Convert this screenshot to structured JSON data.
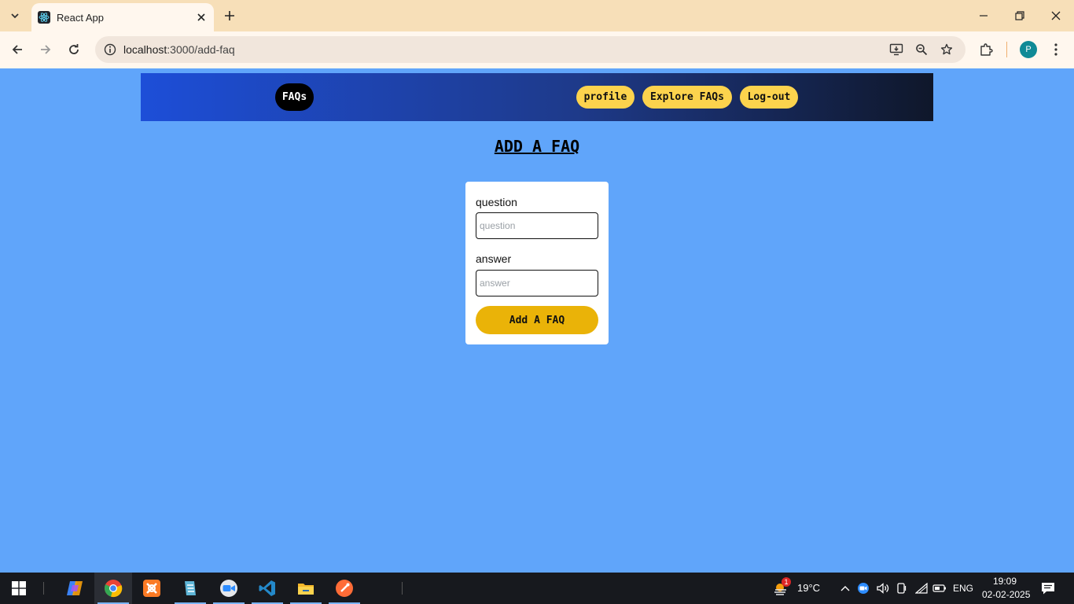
{
  "browser": {
    "tab_title": "React App",
    "url_host": "localhost",
    "url_path": ":3000/add-faq",
    "avatar_letter": "P",
    "icons": [
      "tab-list-icon",
      "react-favicon-icon",
      "close-tab-icon",
      "new-tab-icon",
      "minimize-icon",
      "restore-icon",
      "close-window-icon",
      "back-icon",
      "forward-icon",
      "reload-icon",
      "site-info-icon",
      "install-app-icon",
      "zoom-icon",
      "bookmark-star-icon",
      "extensions-icon",
      "menu-icon"
    ]
  },
  "navbar": {
    "brand": "FAQs",
    "links": [
      "profile",
      "Explore FAQs",
      "Log-out"
    ],
    "gradient": [
      "#1d4ed8",
      "#1e3a8a",
      "#0f172a"
    ],
    "pill_color": "#fcd34d"
  },
  "page": {
    "title": "ADD A FAQ",
    "background": "#60a5fa"
  },
  "form": {
    "question_label": "question",
    "question_placeholder": "question",
    "question_value": "",
    "answer_label": "answer",
    "answer_placeholder": "answer",
    "answer_value": "",
    "submit_label": "Add A FAQ",
    "submit_color": "#eab308"
  },
  "taskbar": {
    "apps": [
      "windows-start-icon",
      "copilot-icon",
      "chrome-icon",
      "xampp-icon",
      "notepad-icon",
      "zoom-app-icon",
      "vscode-icon",
      "file-explorer-icon",
      "postman-icon"
    ],
    "weather_temp": "19°C",
    "weather_badge": "1",
    "language": "ENG",
    "time": "19:09",
    "date": "02-02-2025"
  }
}
